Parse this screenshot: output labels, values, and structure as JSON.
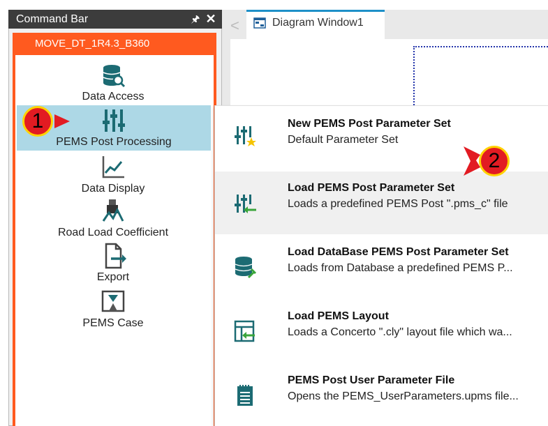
{
  "command_bar": {
    "title": "Command Bar",
    "pin_glyph": "🖈",
    "close_glyph": "✕",
    "project": "MOVE_DT_1R4.3_B360",
    "items": [
      {
        "label": "Data Access",
        "icon": "database-search-icon"
      },
      {
        "label": "PEMS Post Processing",
        "icon": "sliders-icon"
      },
      {
        "label": "Data Display",
        "icon": "line-chart-icon"
      },
      {
        "label": "Road Load Coefficient",
        "icon": "road-load-icon"
      },
      {
        "label": "Export",
        "icon": "export-icon"
      },
      {
        "label": "PEMS Case",
        "icon": "case-icon"
      }
    ]
  },
  "diagram": {
    "tab_label": "Diagram Window1",
    "back_glyph": "<"
  },
  "menu": {
    "items": [
      {
        "title": "New PEMS Post Parameter Set",
        "desc": "Default Parameter Set",
        "icon": "new-parameter-set-icon"
      },
      {
        "title": "Load PEMS Post Parameter Set",
        "desc": "Loads a predefined PEMS Post \".pms_c\" file",
        "icon": "load-parameter-set-icon"
      },
      {
        "title": "Load DataBase PEMS Post Parameter Set",
        "desc": "Loads from Database a predefined PEMS P...",
        "icon": "database-load-icon"
      },
      {
        "title": "Load PEMS Layout",
        "desc": "Loads a Concerto \".cly\" layout file which wa...",
        "icon": "layout-load-icon"
      },
      {
        "title": "PEMS Post User Parameter File",
        "desc": "Opens the PEMS_UserParameters.upms file...",
        "icon": "notepad-icon"
      }
    ]
  },
  "annotations": {
    "step1": "1",
    "step2": "2"
  },
  "colors": {
    "accent": "#ff5a1f",
    "selected": "#add8e6",
    "icon_teal": "#1c6b73",
    "badge_red": "#e21b22",
    "badge_ring": "#ffd200"
  }
}
